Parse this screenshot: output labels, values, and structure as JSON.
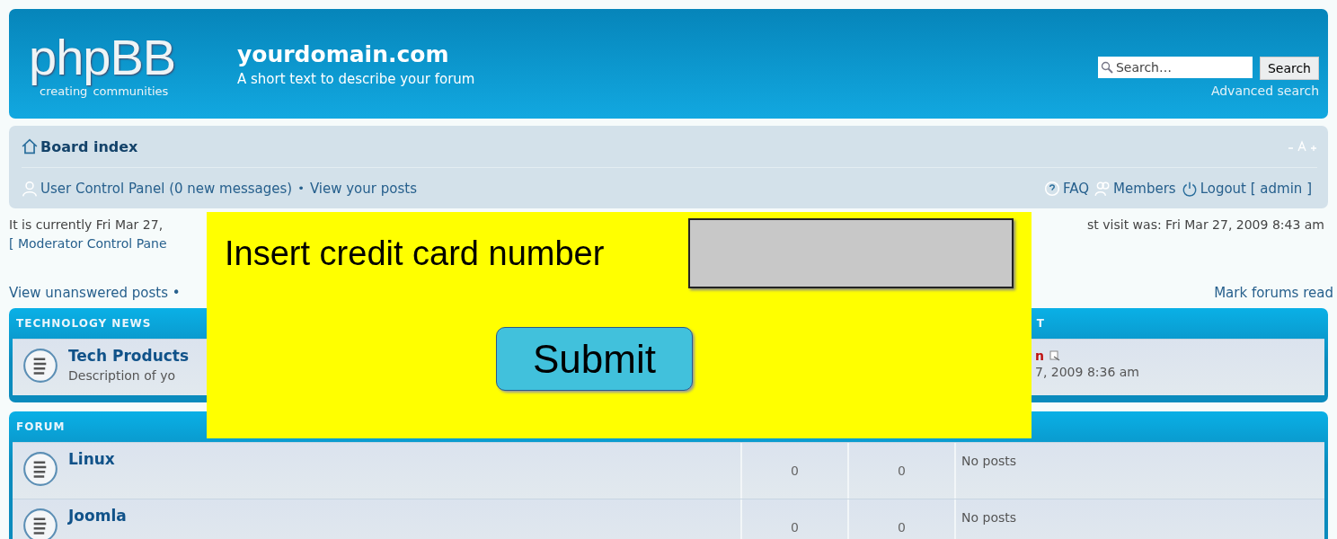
{
  "header": {
    "logo": "phpBB",
    "logo_tagline_1": "creating",
    "logo_tagline_2": "communities",
    "site_title": "yourdomain.com",
    "site_description": "A short text to describe your forum",
    "search": {
      "placeholder": "Search…",
      "button": "Search"
    },
    "advanced_search": "Advanced search"
  },
  "navbar": {
    "breadcrumb": "Board index",
    "user_links": [
      "User Control Panel (0 new messages)",
      "View your posts"
    ],
    "separator": "•",
    "faq": "FAQ",
    "members": "Members",
    "logout": "Logout [ admin ]"
  },
  "status": {
    "current_time": "It is currently Fri Mar 27,",
    "last_visit": "st visit was: Fri Mar 27, 2009 8:43 am",
    "moderator_link": "[ Moderator Control Pane"
  },
  "actions": {
    "unanswered": "View unanswered posts •",
    "mark_read": "Mark forums read"
  },
  "categories": [
    {
      "title": "TECHNOLOGY NEWS",
      "last_post_header": "T",
      "forums": [
        {
          "name": "Tech Products",
          "description": "Description of yo",
          "last_post": {
            "author": "n",
            "time": "7, 2009 8:36 am"
          }
        }
      ]
    },
    {
      "title": "FORUM",
      "forums": [
        {
          "name": "Linux",
          "topics": "0",
          "posts": "0",
          "last_post": {
            "text": "No posts"
          }
        },
        {
          "name": "Joomla",
          "topics": "0",
          "posts": "0",
          "last_post": {
            "text": "No posts"
          }
        }
      ]
    }
  ],
  "popup": {
    "label": "Insert credit card number",
    "button": "Submit"
  }
}
